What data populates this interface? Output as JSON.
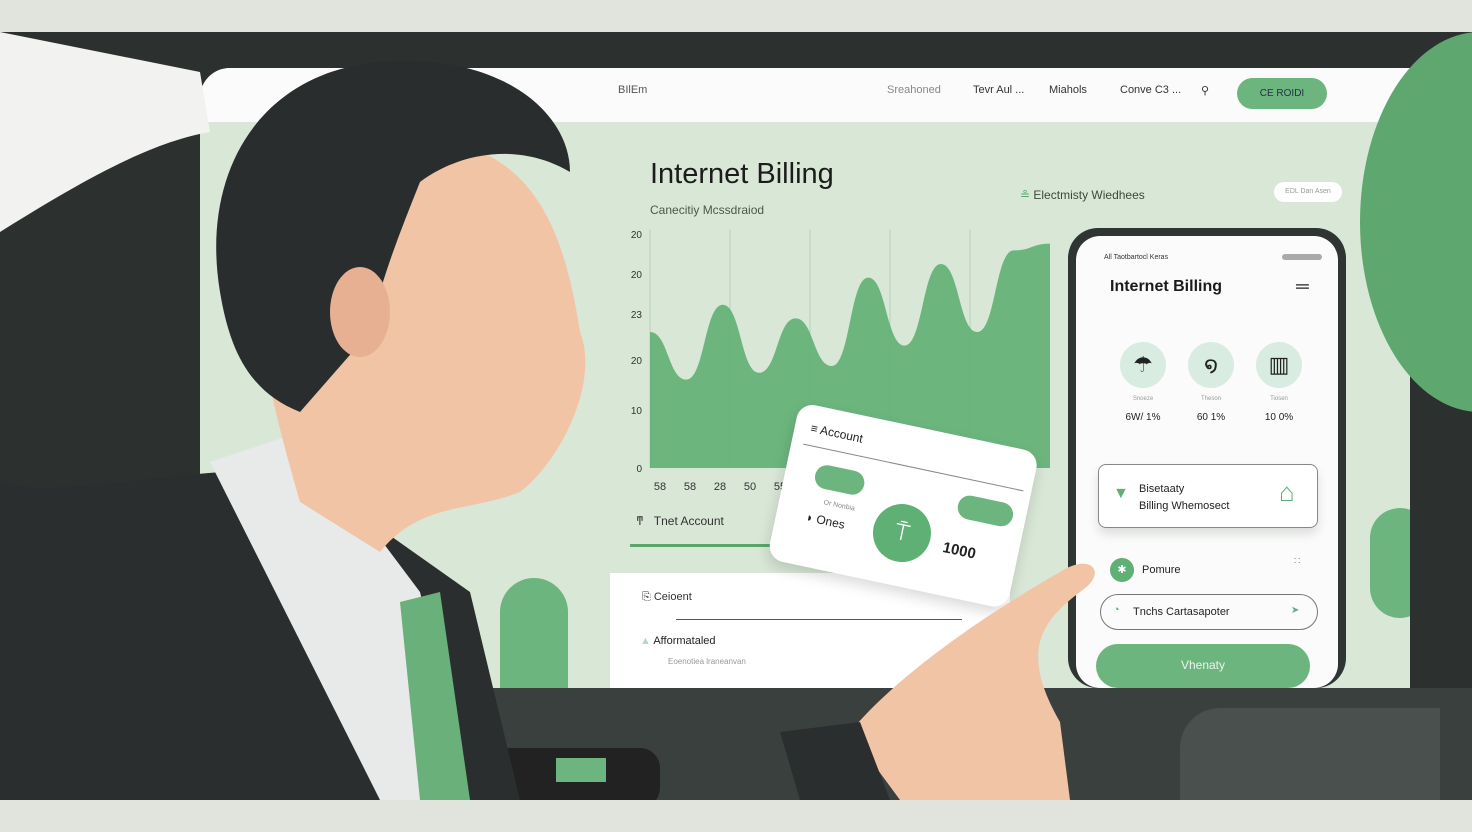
{
  "nav": {
    "logo": "BIlEm",
    "items": [
      "Sreahoned",
      "Tevr Aul ...",
      "Miahols",
      "Conve C3 ..."
    ],
    "cta": "CE ROIDI"
  },
  "main": {
    "title": "Internet Billing",
    "subtitle": "Canecitiy Mcssdraiod",
    "legend": "Electmisty Wiedhees",
    "pill": "EDL Dan Asen",
    "account_row": "Tnet Account",
    "account_progress": 0.54,
    "panel": {
      "row1": "Ceioent",
      "row2": "Afformataled",
      "row2_sub": "Eoenotiea lraneanvan"
    }
  },
  "chart_data": {
    "type": "area",
    "y_tick_labels": [
      "20",
      "20",
      "23",
      "20",
      "10",
      "0"
    ],
    "x_tick_labels": [
      "58",
      "58",
      "28",
      "50",
      "55"
    ],
    "values": [
      20,
      13,
      24,
      14,
      22,
      15,
      28,
      18,
      30,
      20,
      32,
      33
    ],
    "color": "#5fb074"
  },
  "card": {
    "title": "Account",
    "left_label": "Or Nonbia",
    "left_value": "Ones",
    "amount": "1000"
  },
  "phone": {
    "status": "All Taotbartocl Keras",
    "title": "Internet Billing",
    "stats": [
      {
        "icon": "umbrella-icon",
        "label": "Snoeze",
        "value": "6W/ 1%"
      },
      {
        "icon": "swirl-icon",
        "label": "Theson",
        "value": "60 1%"
      },
      {
        "icon": "building-icon",
        "label": "Tiosen",
        "value": "10 0%"
      }
    ],
    "billing_line1": "Bisetaaty",
    "billing_line2": "Billing Whemosect",
    "row": "Pomure",
    "input": "Tnchs Cartasapoter",
    "button": "Vhenaty"
  },
  "colors": {
    "accent": "#6db57f",
    "bg": "#d9e7d7",
    "frame": "#2c302f"
  }
}
